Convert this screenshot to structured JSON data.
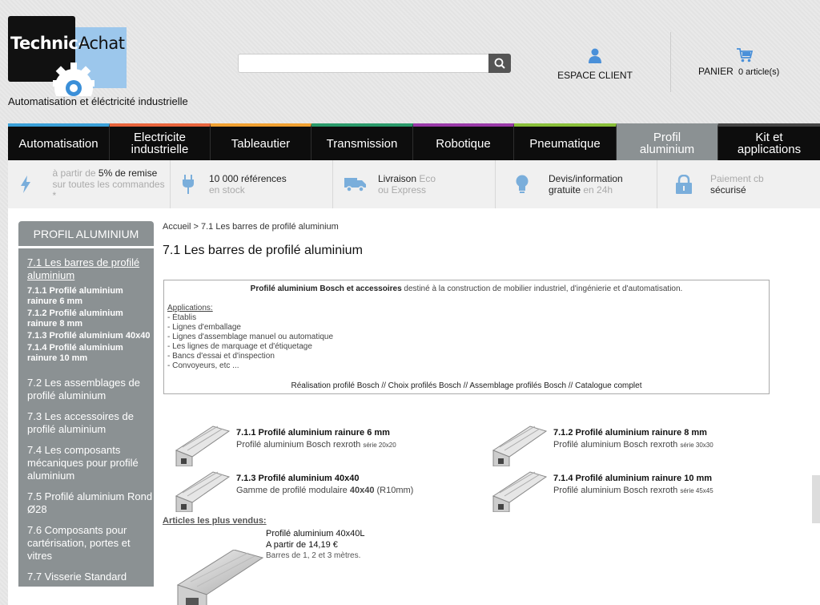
{
  "header": {
    "logo_left": "Technic-",
    "logo_right": "Achat",
    "tagline": "Automatisation et éléctricité industrielle",
    "search_placeholder": "",
    "espace_client": "ESPACE CLIENT",
    "panier": "PANIER",
    "panier_count": "0 article(s)"
  },
  "nav": [
    {
      "label": "Automatisation",
      "color": "#3aa0d8",
      "active": false
    },
    {
      "label": "Electricite industrielle",
      "color": "#e8643c",
      "active": false
    },
    {
      "label": "Tableautier",
      "color": "#f0a030",
      "active": false
    },
    {
      "label": "Transmission",
      "color": "#2a9a6a",
      "active": false
    },
    {
      "label": "Robotique",
      "color": "#9a3aa8",
      "active": false
    },
    {
      "label": "Pneumatique",
      "color": "#8ac03a",
      "active": false
    },
    {
      "label": "Profil aluminium",
      "color": "#8b9193",
      "active": true
    },
    {
      "label": "Kit et applications",
      "color": "#444444",
      "active": false
    }
  ],
  "advantages": [
    {
      "pre": "à partir de ",
      "em": "5% de remise",
      "post": "sur toutes les commandes *",
      "icon": "lightning-icon"
    },
    {
      "pre": "",
      "em": "10 000 références",
      "post": "en stock",
      "icon": "plug-icon"
    },
    {
      "pre": "",
      "em": "Livraison",
      "post_inline": " Eco",
      "post": "ou Express",
      "icon": "truck-icon"
    },
    {
      "pre": "",
      "em": "Devis/information",
      "post_em": "gratuite",
      "post": " en 24h",
      "icon": "lightbulb-icon"
    },
    {
      "pre": "",
      "em": "",
      "line1": "Paiement cb",
      "line2": "sécurisé",
      "icon": "lock-icon"
    }
  ],
  "sidebar": {
    "title": "PROFIL ALUMINIUM",
    "selected": "7.1 Les barres de profilé aluminium",
    "subs": [
      "7.1.1 Profilé aluminium rainure 6 mm",
      "7.1.2 Profilé aluminium rainure 8 mm",
      "7.1.3 Profilé aluminium 40x40",
      "7.1.4 Profilé aluminium rainure 10 mm"
    ],
    "cats": [
      "7.2 Les assemblages de profilé aluminium",
      "7.3 Les accessoires de profilé aluminium",
      "7.4 Les composants mécaniques pour profilé aluminium",
      "7.5 Profilé aluminium Rond Ø28",
      "7.6 Composants pour cartérisation, portes et vitres",
      "7.7 Visserie Standard"
    ]
  },
  "breadcrumb": "Accueil > 7.1 Les barres de profilé aluminium",
  "page_title": "7.1 Les barres de profilé aluminium",
  "description": {
    "intro_bold": "Profilé aluminium Bosch et accessoires",
    "intro_rest": " destiné à la construction de mobilier industriel, d'ingénierie et d'automatisation.",
    "apps_title": "Applications:",
    "apps": [
      "- Établis",
      "- Lignes d'emballage",
      "- Lignes d'assemblage manuel ou automatique",
      "- Les lignes de marquage et d'étiquetage",
      "- Bancs d'essai et d'inspection",
      "- Convoyeurs, etc ..."
    ],
    "links": "Réalisation profilé Bosch // Choix profilés Bosch // Assemblage profilés Bosch // Catalogue complet"
  },
  "products": [
    {
      "title": "7.1.1 Profilé aluminium rainure 6 mm",
      "sub": "Profilé aluminium Bosch rexroth ",
      "small": "série 20x20"
    },
    {
      "title": "7.1.2 Profilé aluminium rainure 8 mm",
      "sub": "Profilé aluminium Bosch rexroth ",
      "small": "série 30x30"
    },
    {
      "title": "7.1.3 Profilé aluminium 40x40",
      "sub": "Gamme de profilé modulaire ",
      "sub_bold": "40x40",
      "sub_after": " (R10mm)"
    },
    {
      "title": "7.1.4 Profilé aluminium rainure 10 mm",
      "sub": "Profilé aluminium Bosch rexroth ",
      "small": "série 45x45"
    }
  ],
  "best_sellers": {
    "title": "Articles les plus vendus:",
    "item_title": "Profilé aluminium 40x40L",
    "item_price": "A partir de 14,19 €",
    "item_desc": "Barres de 1, 2 et 3 mètres."
  }
}
